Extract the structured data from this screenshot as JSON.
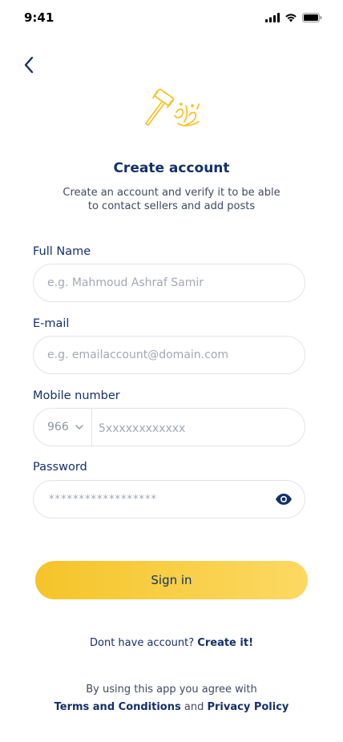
{
  "status_bar": {
    "time": "9:41"
  },
  "header": {
    "title": "Create account",
    "subtitle_line1": "Create an account and verify it to be able",
    "subtitle_line2": "to contact sellers and add posts"
  },
  "form": {
    "full_name": {
      "label": "Full Name",
      "placeholder": "e.g. Mahmoud Ashraf Samir"
    },
    "email": {
      "label": "E-mail",
      "placeholder": "e.g. emailaccount@domain.com"
    },
    "mobile": {
      "label": "Mobile number",
      "country_code": "966",
      "placeholder": "5xxxxxxxxxxxx"
    },
    "password": {
      "label": "Password",
      "masked_value": "******************"
    }
  },
  "actions": {
    "sign_in_label": "Sign in"
  },
  "signup": {
    "prompt": "Dont have account?",
    "link": "Create it!"
  },
  "terms": {
    "line1": "By using this app you agree with",
    "terms_link": "Terms and Conditions",
    "and": "and",
    "privacy_link": "Privacy Policy"
  },
  "colors": {
    "primary": "#14306b",
    "accent_start": "#f5c429",
    "accent_end": "#fcd963"
  }
}
